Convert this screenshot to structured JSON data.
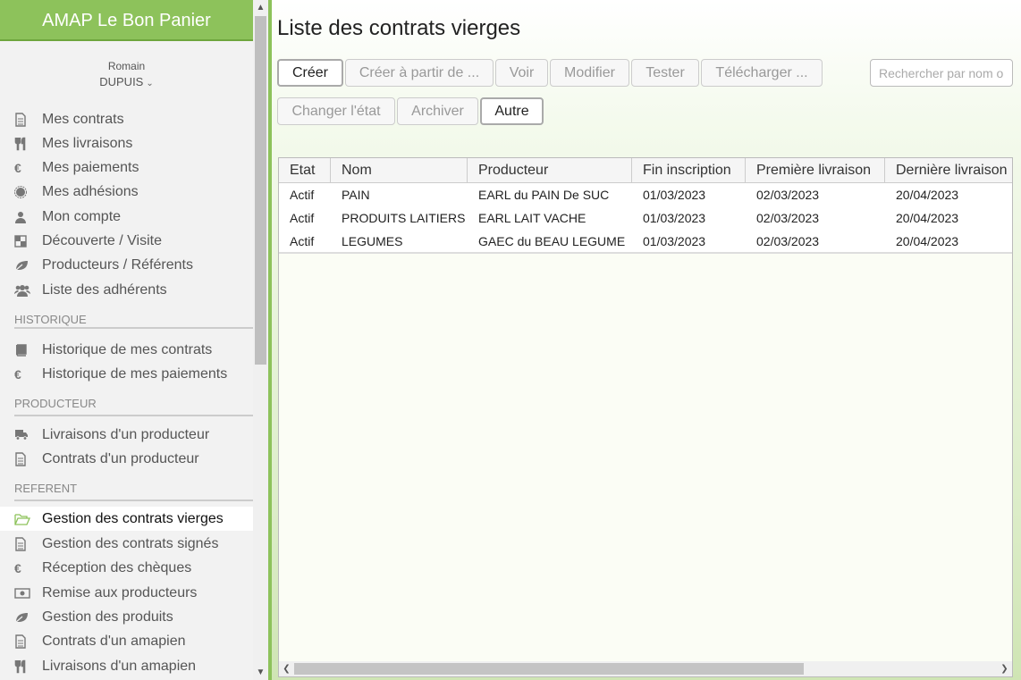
{
  "app": {
    "title": "AMAP Le Bon Panier"
  },
  "user": {
    "first_name": "Romain",
    "last_name": "DUPUIS"
  },
  "nav": {
    "main": [
      {
        "label": "Mes contrats",
        "icon": "document-icon"
      },
      {
        "label": "Mes livraisons",
        "icon": "fork-knife-icon"
      },
      {
        "label": "Mes paiements",
        "icon": "euro-icon"
      },
      {
        "label": "Mes adhésions",
        "icon": "badge-icon"
      },
      {
        "label": "Mon compte",
        "icon": "user-icon"
      },
      {
        "label": "Découverte / Visite",
        "icon": "compass-icon"
      },
      {
        "label": "Producteurs / Référents",
        "icon": "leaf-icon"
      },
      {
        "label": "Liste des adhérents",
        "icon": "users-icon"
      }
    ],
    "historique_title": "HISTORIQUE",
    "historique": [
      {
        "label": "Historique de mes contrats",
        "icon": "book-icon"
      },
      {
        "label": "Historique de mes paiements",
        "icon": "euro-icon"
      }
    ],
    "producteur_title": "PRODUCTEUR",
    "producteur": [
      {
        "label": "Livraisons d'un producteur",
        "icon": "truck-icon"
      },
      {
        "label": "Contrats d'un producteur",
        "icon": "document-icon"
      }
    ],
    "referent_title": "REFERENT",
    "referent": [
      {
        "label": "Gestion des contrats vierges",
        "icon": "folder-open-icon"
      },
      {
        "label": "Gestion des contrats signés",
        "icon": "document-icon"
      },
      {
        "label": "Réception des chèques",
        "icon": "euro-icon"
      },
      {
        "label": "Remise aux producteurs",
        "icon": "money-icon"
      },
      {
        "label": "Gestion des produits",
        "icon": "leaf-icon"
      },
      {
        "label": "Contrats d'un amapien",
        "icon": "document-icon"
      },
      {
        "label": "Livraisons d'un amapien",
        "icon": "fork-knife-icon"
      }
    ]
  },
  "page": {
    "title": "Liste des contrats vierges",
    "toolbar": {
      "creer": "Créer",
      "creer_partir": "Créer à partir de ...",
      "voir": "Voir",
      "modifier": "Modifier",
      "tester": "Tester",
      "telecharger": "Télécharger ...",
      "changer_etat": "Changer l'état",
      "archiver": "Archiver",
      "autre": "Autre"
    },
    "search": {
      "placeholder": "Rechercher par nom ou producteur",
      "value": ""
    }
  },
  "table": {
    "columns": [
      "Etat",
      "Nom",
      "Producteur",
      "Fin inscription",
      "Première livraison",
      "Dernière livraison"
    ],
    "rows": [
      [
        "Actif",
        "PAIN",
        "EARL du PAIN De SUC",
        "01/03/2023",
        "02/03/2023",
        "20/04/2023"
      ],
      [
        "Actif",
        "PRODUITS LAITIERS de VACHE",
        "EARL LAIT VACHE",
        "01/03/2023",
        "02/03/2023",
        "20/04/2023"
      ],
      [
        "Actif",
        "LEGUMES",
        "GAEC du BEAU LEGUME",
        "01/03/2023",
        "02/03/2023",
        "20/04/2023"
      ]
    ]
  },
  "colors": {
    "accent": "#8dc25b"
  }
}
